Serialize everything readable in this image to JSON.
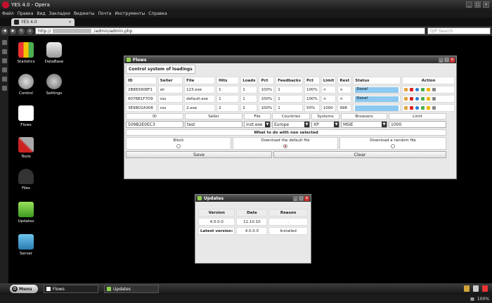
{
  "browser": {
    "title": "YES 4.0 - Opera",
    "menu": [
      "Файл",
      "Правка",
      "Вид",
      "Закладки",
      "Виджеты",
      "Почта",
      "Инструменты",
      "Справка"
    ],
    "tab": "YES 4.0",
    "url_prefix": "http://",
    "url_path": "/admin/admin.php",
    "search_placeholder": "QIP Search",
    "zoom": "100%"
  },
  "desktop": [
    {
      "label": "Statistics"
    },
    {
      "label": "DataBase"
    },
    {
      "label": "Control"
    },
    {
      "label": "Settings"
    },
    {
      "label": "Flows"
    },
    {
      "label": "Tools"
    },
    {
      "label": "Files"
    },
    {
      "label": "Updates"
    },
    {
      "label": "Server"
    }
  ],
  "flows": {
    "title": "Flows",
    "section": "Control system of loadings",
    "headers": [
      "ID",
      "Seller",
      "File",
      "Hits",
      "Loads",
      "Pct",
      "Feedbacks",
      "Pct",
      "Limit",
      "Rest",
      "Status",
      "Action"
    ],
    "rows": [
      [
        "2B883908F1",
        "wl",
        "123.exe",
        "1",
        "1",
        "100%",
        "1",
        "100%",
        "∞",
        "∞",
        "Done!"
      ],
      [
        "8076B1F7D9",
        "sss",
        "default.exe",
        "1",
        "1",
        "100%",
        "1",
        "100%",
        "∞",
        "∞",
        "Done!"
      ],
      [
        "3E98D2A306",
        "sss",
        "2.exe",
        "2",
        "2",
        "100%",
        "1",
        "50%",
        "1000",
        "998",
        ""
      ]
    ],
    "form_headers": [
      "ID",
      "Seller",
      "File",
      "Countries",
      "Systems",
      "Browsers",
      "Limit"
    ],
    "form_values": {
      "id": "509B2E0EC3",
      "seller": "test",
      "file": "inst.exe",
      "country": "Europe",
      "system": "XP",
      "browser": "MSIE",
      "limit": "1000"
    },
    "nonselected_title": "What to do with non selected",
    "options": [
      "Block",
      "Download the default file",
      "Download a random file"
    ],
    "save": "Save",
    "clear": "Clear"
  },
  "updates": {
    "title": "Updates",
    "headers": [
      "Version",
      "Date",
      "Reason"
    ],
    "row": [
      "4.0.0.0",
      "11.10.10",
      "."
    ],
    "latest_label": "Latest version:",
    "latest_value": "4.0.0.0",
    "latest_status": "Installed"
  },
  "taskbar": {
    "menu": "Menu",
    "tasks": [
      "Flows",
      "Updates"
    ]
  }
}
